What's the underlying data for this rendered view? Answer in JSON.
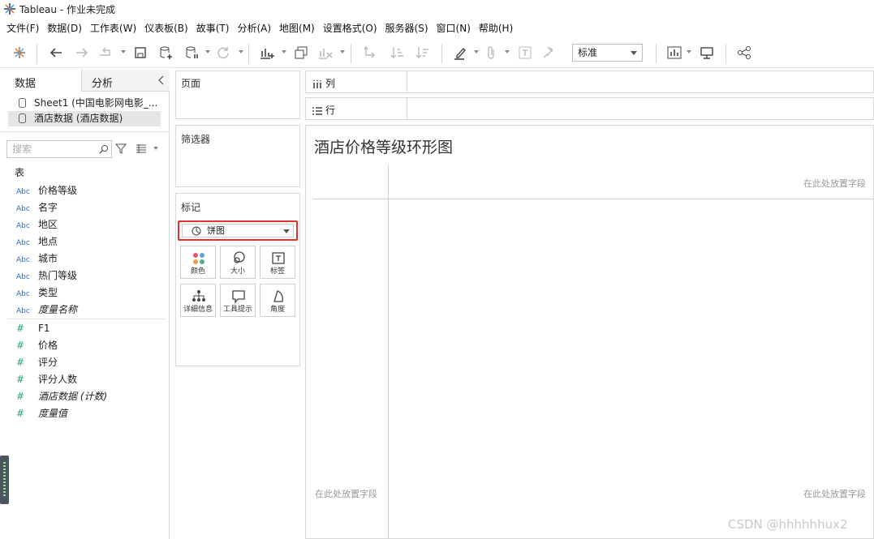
{
  "window": {
    "title": "Tableau - 作业未完成"
  },
  "menu": [
    "文件(F)",
    "数据(D)",
    "工作表(W)",
    "仪表板(B)",
    "故事(T)",
    "分析(A)",
    "地图(M)",
    "设置格式(O)",
    "服务器(S)",
    "窗口(N)",
    "帮助(H)"
  ],
  "toolbar": {
    "fit_value": "标准"
  },
  "leftpane": {
    "tab_data": "数据",
    "tab_analysis": "分析",
    "datasources": [
      "Sheet1 (中国电影网电影_...",
      "酒店数据 (酒店数据)"
    ],
    "search_placeholder": "搜索",
    "table_heading": "表",
    "dimensions": [
      {
        "icon": "Abc",
        "label": "价格等级"
      },
      {
        "icon": "Abc",
        "label": "名字"
      },
      {
        "icon": "Abc",
        "label": "地区"
      },
      {
        "icon": "Abc",
        "label": "地点"
      },
      {
        "icon": "Abc",
        "label": "城市"
      },
      {
        "icon": "Abc",
        "label": "热门等级"
      },
      {
        "icon": "Abc",
        "label": "类型"
      },
      {
        "icon": "Abc",
        "label": "度量名称"
      }
    ],
    "measures": [
      {
        "icon": "#",
        "label": "F1"
      },
      {
        "icon": "#",
        "label": "价格"
      },
      {
        "icon": "#",
        "label": "评分"
      },
      {
        "icon": "#",
        "label": "评分人数"
      },
      {
        "icon": "#",
        "label": "酒店数据 (计数)"
      },
      {
        "icon": "#",
        "label": "度量值"
      }
    ]
  },
  "cards": {
    "pages": "页面",
    "filters": "筛选器",
    "marks": "标记",
    "mark_type": "饼图",
    "mark_buttons": [
      "颜色",
      "大小",
      "标签",
      "详细信息",
      "工具提示",
      "角度"
    ]
  },
  "shelves": {
    "columns": "列",
    "rows": "行"
  },
  "view": {
    "title": "酒店价格等级环形图",
    "drop_field_hint": "在此处放置字段"
  },
  "watermark": "CSDN @hhhhhhux2",
  "colors": {
    "highlight": "#e3312c",
    "dimension": "#2a6cc4",
    "measure": "#2e9e84"
  }
}
